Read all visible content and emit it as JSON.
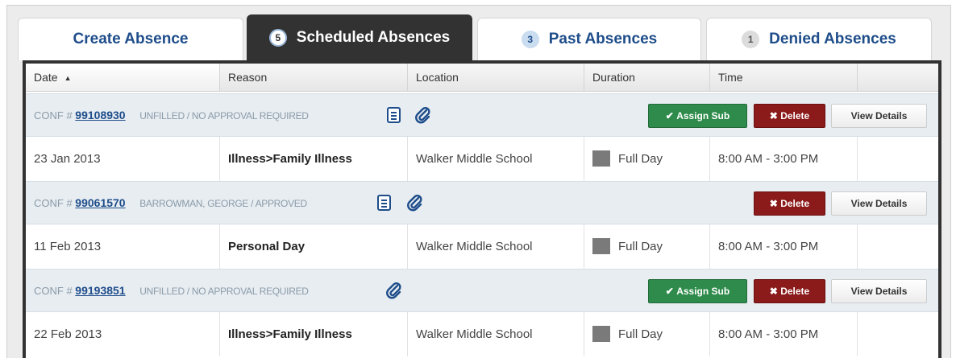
{
  "tabs": [
    {
      "label": "Create Absence",
      "badge": ""
    },
    {
      "label": "Scheduled Absences",
      "badge": "5"
    },
    {
      "label": "Past Absences",
      "badge": "3"
    },
    {
      "label": "Denied Absences",
      "badge": "1"
    }
  ],
  "columns": [
    "Date",
    "Reason",
    "Location",
    "Duration",
    "Time"
  ],
  "buttons": {
    "assign": "Assign Sub",
    "delete": "Delete",
    "view": "View Details"
  },
  "conf_prefix": "CONF #",
  "absences": [
    {
      "conf": "99108930",
      "status": "UNFILLED / NO APPROVAL REQUIRED",
      "date": "23 Jan 2013",
      "reason": "Illness>Family Illness",
      "location": "Walker Middle School",
      "duration": "Full Day",
      "time": "8:00 AM - 3:00 PM"
    },
    {
      "conf": "99061570",
      "status": "BARROWMAN, GEORGE / APPROVED",
      "date": "11 Feb 2013",
      "reason": "Personal Day",
      "location": "Walker Middle School",
      "duration": "Full Day",
      "time": "8:00 AM - 3:00 PM"
    },
    {
      "conf": "99193851",
      "status": "UNFILLED / NO APPROVAL REQUIRED",
      "date": "22 Feb 2013",
      "reason": "Illness>Family Illness",
      "location": "Walker Middle School",
      "duration": "Full Day",
      "time": "8:00 AM - 3:00 PM"
    }
  ],
  "icons": {
    "notes": "document-icon",
    "attachment": "paperclip-icon",
    "check": "check-icon",
    "x": "x-icon",
    "sort": "sort-up-icon"
  },
  "colors": {
    "tab_active": "#323232",
    "link": "#1e4d8a",
    "assign": "#2e8b4b",
    "delete": "#8b1a1a",
    "conf_row": "#e8edf2"
  }
}
